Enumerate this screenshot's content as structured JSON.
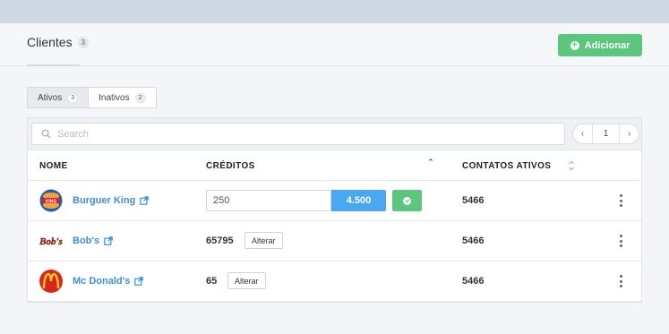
{
  "header": {
    "title": "Clientes",
    "count": "3",
    "add_label": "Adicionar"
  },
  "tabs": [
    {
      "label": "Ativos",
      "count": "3",
      "active": true
    },
    {
      "label": "Inativos",
      "count": "2",
      "active": false
    }
  ],
  "search": {
    "placeholder": "Search"
  },
  "pagination": {
    "page": "1",
    "prev_icon": "chevron-left-icon",
    "next_icon": "chevron-right-icon"
  },
  "table": {
    "columns": [
      "NOME",
      "CRÉDITOS",
      "CONTATOS ATIVOS"
    ],
    "rows": [
      {
        "name": "Burguer King",
        "credits_input": "250",
        "credits_total": "4.500",
        "contacts": "5466",
        "logo": "burger-king-logo"
      },
      {
        "name": "Bob's",
        "credits": "65795",
        "alter_label": "Alterar",
        "contacts": "5466",
        "logo": "bobs-logo"
      },
      {
        "name": "Mc Donald's",
        "credits": "65",
        "alter_label": "Alterar",
        "contacts": "5466",
        "logo": "mcdonalds-logo"
      }
    ]
  },
  "colors": {
    "accent_green": "#5cc67d",
    "accent_blue": "#4aa8f0",
    "link_blue": "#3a8fd8"
  }
}
